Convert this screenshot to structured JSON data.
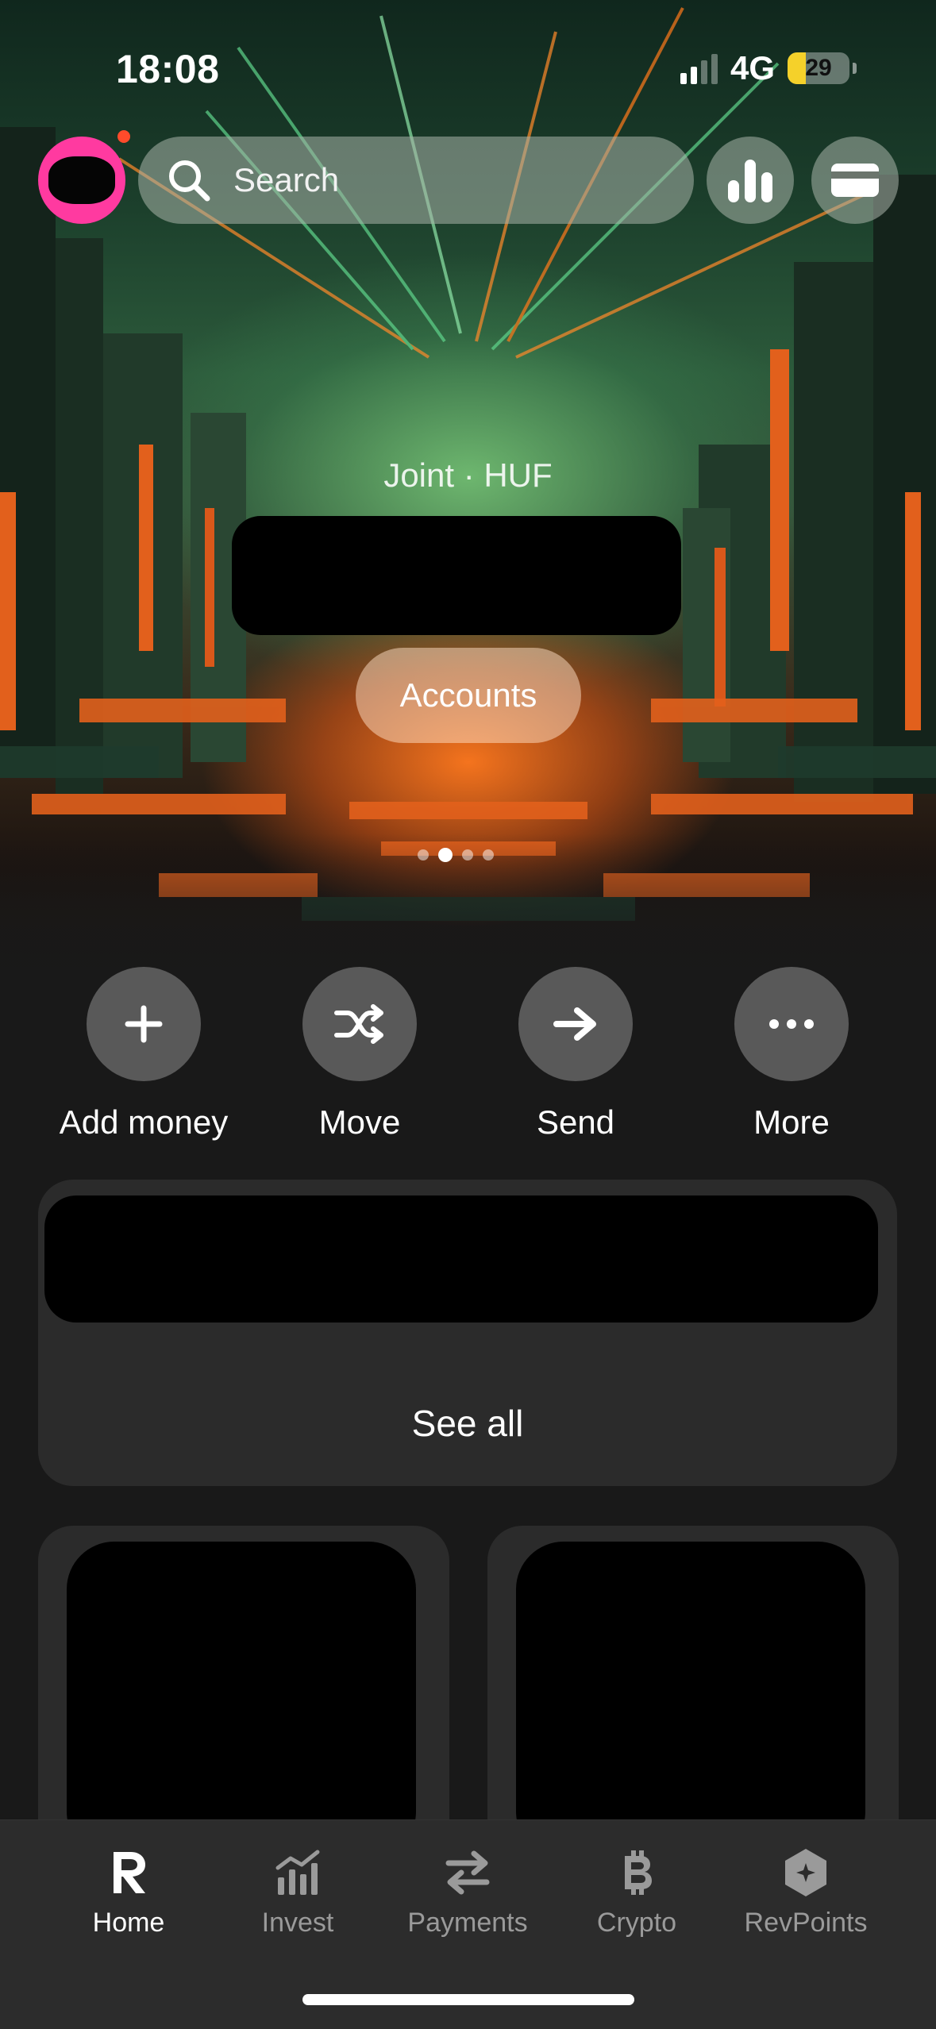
{
  "status_bar": {
    "time": "18:08",
    "network": "4G",
    "battery": "29",
    "battery_color": "#f5d12a"
  },
  "top_bar": {
    "search_placeholder": "Search",
    "analytics_icon": "bar-chart-icon",
    "cards_icon": "card-icon",
    "notification_dot_color": "#ff4b2b",
    "avatar_ring_color": "#ff3aa0"
  },
  "account": {
    "label": "Joint · HUF",
    "accounts_button": "Accounts",
    "pager_count": 4,
    "pager_active_index": 1
  },
  "actions": [
    {
      "label": "Add money",
      "icon": "plus-icon"
    },
    {
      "label": "Move",
      "icon": "shuffle-icon"
    },
    {
      "label": "Send",
      "icon": "arrow-right-icon"
    },
    {
      "label": "More",
      "icon": "more-dots-icon"
    }
  ],
  "transactions_card": {
    "see_all": "See all"
  },
  "tabs": [
    {
      "label": "Home",
      "icon": "revolut-r-icon",
      "active": true
    },
    {
      "label": "Invest",
      "icon": "invest-chart-icon",
      "active": false
    },
    {
      "label": "Payments",
      "icon": "transfer-arrows-icon",
      "active": false
    },
    {
      "label": "Crypto",
      "icon": "bitcoin-icon",
      "active": false
    },
    {
      "label": "RevPoints",
      "icon": "revpoints-hexagon-icon",
      "active": false
    }
  ]
}
